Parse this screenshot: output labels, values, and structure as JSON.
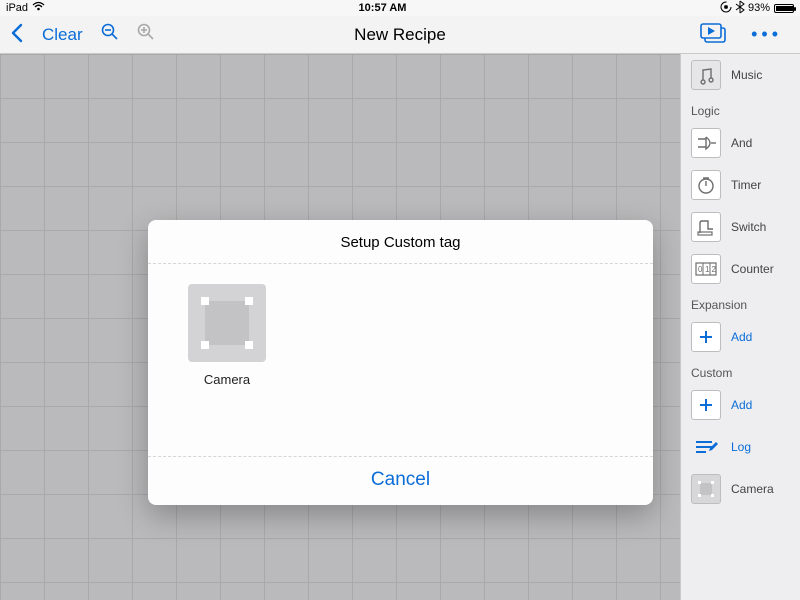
{
  "status": {
    "device": "iPad",
    "time": "10:57 AM",
    "battery_pct": "93%",
    "battery_fill_pct": 93
  },
  "toolbar": {
    "clear": "Clear",
    "title": "New Recipe"
  },
  "sidebar": {
    "top_items": [
      {
        "label": "Music"
      }
    ],
    "sections": [
      {
        "name": "Logic",
        "items": [
          {
            "label": "And"
          },
          {
            "label": "Timer"
          },
          {
            "label": "Switch"
          },
          {
            "label": "Counter"
          }
        ]
      },
      {
        "name": "Expansion",
        "items": [
          {
            "label": "Add",
            "blue": true
          }
        ]
      },
      {
        "name": "Custom",
        "items": [
          {
            "label": "Add",
            "blue": true
          },
          {
            "label": "Log",
            "blue": true
          },
          {
            "label": "Camera"
          }
        ]
      }
    ]
  },
  "modal": {
    "title": "Setup Custom tag",
    "tile_label": "Camera",
    "cancel": "Cancel"
  }
}
